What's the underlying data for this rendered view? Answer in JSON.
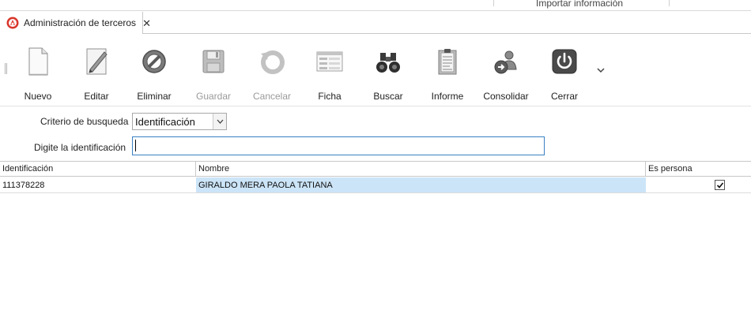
{
  "header": {
    "import_label": "Importar información"
  },
  "tab": {
    "title": "Administración de terceros",
    "close_glyph": "✕",
    "icon": "app-logo-icon"
  },
  "toolbar": {
    "buttons": [
      {
        "label": "Nuevo",
        "icon": "new-document-icon",
        "enabled": true
      },
      {
        "label": "Editar",
        "icon": "pencil-edit-icon",
        "enabled": true
      },
      {
        "label": "Eliminar",
        "icon": "delete-circle-icon",
        "enabled": true
      },
      {
        "label": "Guardar",
        "icon": "save-disk-icon",
        "enabled": false
      },
      {
        "label": "Cancelar",
        "icon": "undo-arrow-icon",
        "enabled": false
      },
      {
        "label": "Ficha",
        "icon": "form-card-icon",
        "enabled": true
      },
      {
        "label": "Buscar",
        "icon": "binoculars-icon",
        "enabled": true
      },
      {
        "label": "Informe",
        "icon": "report-clipboard-icon",
        "enabled": true
      },
      {
        "label": "Consolidar",
        "icon": "consolidate-user-icon",
        "enabled": true
      },
      {
        "label": "Cerrar",
        "icon": "power-icon",
        "enabled": true
      }
    ]
  },
  "filters": {
    "criterio_label": "Criterio de busqueda",
    "criterio_value": "Identificación",
    "digite_label": "Digite la identificación",
    "digite_value": ""
  },
  "grid": {
    "columns": [
      "Identificación",
      "Nombre",
      "Es persona"
    ],
    "rows": [
      {
        "identificacion": "111378228",
        "nombre": "GIRALDO MERA PAOLA TATIANA",
        "es_persona": true
      }
    ]
  },
  "colors": {
    "selection": "#cce4f7",
    "input_focus_border": "#3a80c2",
    "close_button_red": "#c0392b"
  }
}
